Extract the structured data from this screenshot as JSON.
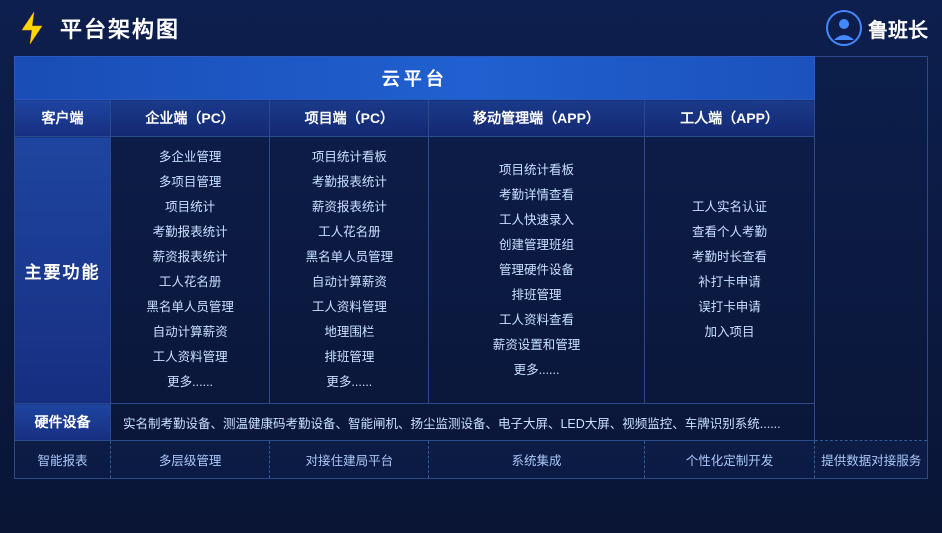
{
  "header": {
    "title": "平台架构图",
    "brand": "鲁班长"
  },
  "cloud": {
    "label": "云平台"
  },
  "columns": {
    "client": "客户端",
    "enterprise_pc": "企业端（PC）",
    "project_pc": "项目端（PC）",
    "mobile_app": "移动管理端（APP）",
    "worker_app": "工人端（APP）"
  },
  "main_label": "主要功能",
  "enterprise_features": [
    "多企业管理",
    "多项目管理",
    "项目统计",
    "考勤报表统计",
    "薪资报表统计",
    "工人花名册",
    "黑名单人员管理",
    "自动计算薪资",
    "工人资料管理",
    "更多......"
  ],
  "project_features": [
    "项目统计看板",
    "考勤报表统计",
    "薪资报表统计",
    "工人花名册",
    "黑名单人员管理",
    "自动计算薪资",
    "工人资料管理",
    "地理围栏",
    "排班管理",
    "更多......"
  ],
  "mobile_features": [
    "项目统计看板",
    "考勤详情查看",
    "工人快速录入",
    "创建管理班组",
    "管理硬件设备",
    "排班管理",
    "工人资料查看",
    "薪资设置和管理",
    "更多......"
  ],
  "worker_features": [
    "工人实名认证",
    "查看个人考勤",
    "考勤时长查看",
    "补打卡申请",
    "误打卡申请",
    "加入项目"
  ],
  "hardware": {
    "label": "硬件设备",
    "content": "实名制考勤设备、测温健康码考勤设备、智能闸机、扬尘监测设备、电子大屏、LED大屏、视频监控、车牌识别系统......"
  },
  "features": [
    "智能报表",
    "多层级管理",
    "对接住建局平台",
    "系统集成",
    "个性化定制开发",
    "提供数据对接服务"
  ]
}
